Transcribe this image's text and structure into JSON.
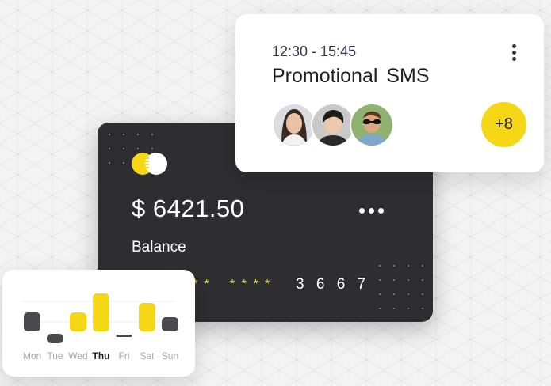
{
  "card": {
    "amount": "$ 6421.50",
    "balance_label": "Balance",
    "masked_group_1": "* *",
    "masked_group_2": "* * * *",
    "last_digits": "3 6 6 7",
    "more_icon": "horizontal-ellipsis-icon",
    "logo_icon": "card-brand-circles-icon",
    "colors": {
      "background": "#2e2e30",
      "accent": "#f5d716"
    }
  },
  "sms": {
    "time_range": "12:30 - 15:45",
    "title": "Promotional  SMS",
    "more_icon": "vertical-ellipsis-icon",
    "extra_count": "+8",
    "avatars": [
      "woman-long-hair",
      "man-dark-hair",
      "man-sunglasses"
    ]
  },
  "week_chart": {
    "days": [
      "Mon",
      "Tue",
      "Wed",
      "Thu",
      "Fri",
      "Sat",
      "Sun"
    ],
    "active_day": "Thu",
    "colors": {
      "up": "#f5d716",
      "down": "#4a4a4d"
    }
  },
  "chart_data": {
    "type": "bar",
    "categories": [
      "Mon",
      "Tue",
      "Wed",
      "Thu",
      "Fri",
      "Sat",
      "Sun"
    ],
    "values": [
      2,
      -1,
      2,
      4,
      -0.2,
      3,
      1.5
    ],
    "ylim": [
      -1.5,
      5
    ],
    "grid": true
  }
}
